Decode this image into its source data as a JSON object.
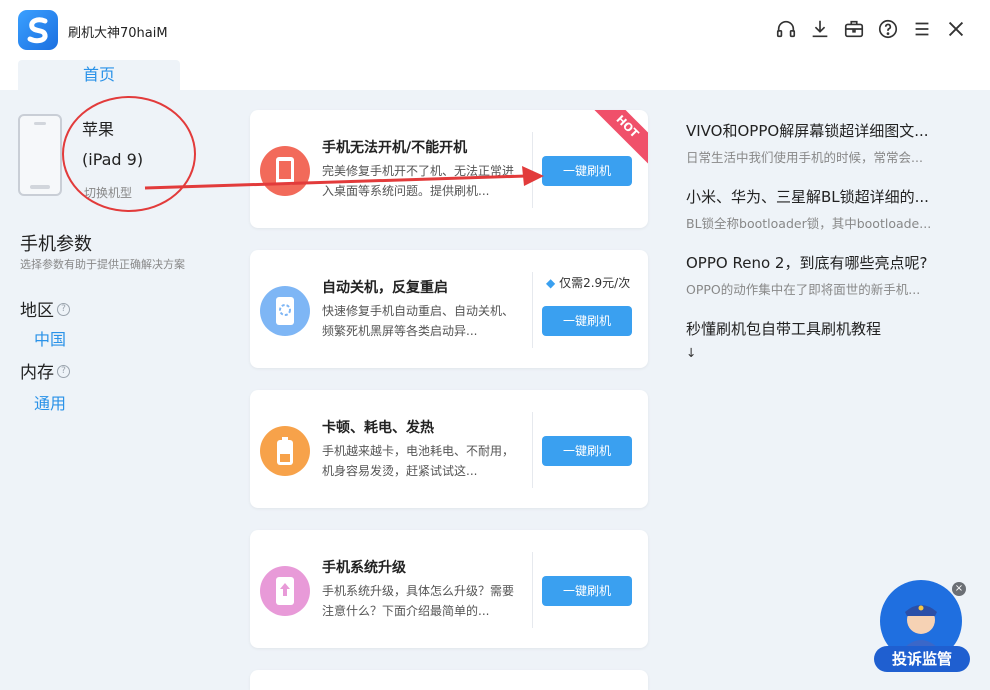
{
  "window": {
    "title": "刷机大神70haiM",
    "controls": [
      "headset-icon",
      "download-icon",
      "toolbox-icon",
      "help-icon",
      "menu-icon",
      "close-icon"
    ]
  },
  "tabs": {
    "home": "首页"
  },
  "device": {
    "brand": "苹果",
    "model": "(iPad 9)",
    "switch_label": "切换机型"
  },
  "params": {
    "title": "手机参数",
    "subtitle": "选择参数有助于提供正确解决方案",
    "region_label": "地区",
    "region_value": "中国",
    "memory_label": "内存",
    "memory_value": "通用"
  },
  "cards": [
    {
      "title": "手机无法开机/不能开机",
      "desc": "完美修复手机开不了机、无法正常进入桌面等系统问题。提供刷机...",
      "button": "一键刷机",
      "badge": "HOT",
      "icon": "phone-icon",
      "icon_color": "#f26a5a"
    },
    {
      "title": "自动关机，反复重启",
      "desc": "快速修复手机自动重启、自动关机、频繁死机黑屏等各类启动异...",
      "button": "一键刷机",
      "price": "仅需2.9元/次",
      "icon": "loading-phone-icon",
      "icon_color": "#7eb6f5"
    },
    {
      "title": "卡顿、耗电、发热",
      "desc": "手机越来越卡，电池耗电、不耐用，机身容易发烫，赶紧试试这...",
      "button": "一键刷机",
      "icon": "battery-icon",
      "icon_color": "#f7a24a"
    },
    {
      "title": "手机系统升级",
      "desc": "手机系统升级，具体怎么升级？需要注意什么？下面介绍最简单的...",
      "button": "一键刷机",
      "icon": "upgrade-icon",
      "icon_color": "#e89ad8"
    }
  ],
  "articles": [
    {
      "title": "VIVO和OPPO解屏幕锁超详细图文...",
      "desc": "日常生活中我们使用手机的时候，常常会..."
    },
    {
      "title": "小米、华为、三星解BL锁超详细的...",
      "desc": "BL锁全称bootloader锁，其中bootloade..."
    },
    {
      "title": "OPPO Reno 2，到底有哪些亮点呢?",
      "desc": "OPPO的动作集中在了即将面世的新手机..."
    },
    {
      "title": "秒懂刷机包自带工具刷机教程",
      "desc": "↓"
    }
  ],
  "complaint": {
    "label": "投诉监管",
    "close": "×"
  },
  "colors": {
    "accent": "#2a92e8",
    "button": "#3aa0f0",
    "hot": "#f0506a",
    "annotation": "#e23b3b"
  }
}
